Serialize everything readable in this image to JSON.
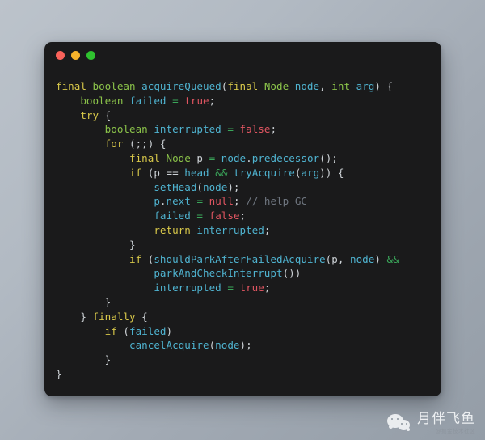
{
  "window": {
    "traffic_lights": [
      {
        "name": "close-button",
        "color": "#f9625a"
      },
      {
        "name": "minimize-button",
        "color": "#f7b32b"
      },
      {
        "name": "maximize-button",
        "color": "#2fc22f"
      }
    ]
  },
  "code": {
    "language": "java",
    "lines": [
      [
        {
          "t": "final ",
          "c": "kw"
        },
        {
          "t": "boolean ",
          "c": "typ"
        },
        {
          "t": "acquireQueued",
          "c": "fn"
        },
        {
          "t": "(",
          "c": "pln"
        },
        {
          "t": "final ",
          "c": "kw"
        },
        {
          "t": "Node ",
          "c": "typ"
        },
        {
          "t": "node",
          "c": "idn"
        },
        {
          "t": ", ",
          "c": "pln"
        },
        {
          "t": "int ",
          "c": "typ"
        },
        {
          "t": "arg",
          "c": "idn"
        },
        {
          "t": ") {",
          "c": "pln"
        }
      ],
      [
        {
          "t": "    ",
          "c": "pln"
        },
        {
          "t": "boolean ",
          "c": "typ"
        },
        {
          "t": "failed",
          "c": "idn"
        },
        {
          "t": " ",
          "c": "pln"
        },
        {
          "t": "=",
          "c": "op"
        },
        {
          "t": " ",
          "c": "pln"
        },
        {
          "t": "true",
          "c": "lit"
        },
        {
          "t": ";",
          "c": "pln"
        }
      ],
      [
        {
          "t": "    ",
          "c": "pln"
        },
        {
          "t": "try",
          "c": "kw"
        },
        {
          "t": " {",
          "c": "pln"
        }
      ],
      [
        {
          "t": "        ",
          "c": "pln"
        },
        {
          "t": "boolean ",
          "c": "typ"
        },
        {
          "t": "interrupted",
          "c": "idn"
        },
        {
          "t": " ",
          "c": "pln"
        },
        {
          "t": "=",
          "c": "op"
        },
        {
          "t": " ",
          "c": "pln"
        },
        {
          "t": "false",
          "c": "lit"
        },
        {
          "t": ";",
          "c": "pln"
        }
      ],
      [
        {
          "t": "        ",
          "c": "pln"
        },
        {
          "t": "for",
          "c": "kw"
        },
        {
          "t": " (;;) {",
          "c": "pln"
        }
      ],
      [
        {
          "t": "            ",
          "c": "pln"
        },
        {
          "t": "final ",
          "c": "kw"
        },
        {
          "t": "Node ",
          "c": "typ"
        },
        {
          "t": "p",
          "c": "pln"
        },
        {
          "t": " ",
          "c": "pln"
        },
        {
          "t": "=",
          "c": "op"
        },
        {
          "t": " ",
          "c": "pln"
        },
        {
          "t": "node",
          "c": "idn"
        },
        {
          "t": ".",
          "c": "pln"
        },
        {
          "t": "predecessor",
          "c": "fn"
        },
        {
          "t": "();",
          "c": "pln"
        }
      ],
      [
        {
          "t": "            ",
          "c": "pln"
        },
        {
          "t": "if",
          "c": "kw"
        },
        {
          "t": " (",
          "c": "pln"
        },
        {
          "t": "p",
          "c": "pln"
        },
        {
          "t": " ",
          "c": "pln"
        },
        {
          "t": "==",
          "c": "pln"
        },
        {
          "t": " ",
          "c": "pln"
        },
        {
          "t": "head",
          "c": "idn"
        },
        {
          "t": " ",
          "c": "pln"
        },
        {
          "t": "&&",
          "c": "op"
        },
        {
          "t": " ",
          "c": "pln"
        },
        {
          "t": "tryAcquire",
          "c": "fn"
        },
        {
          "t": "(",
          "c": "pln"
        },
        {
          "t": "arg",
          "c": "idn"
        },
        {
          "t": ")) {",
          "c": "pln"
        }
      ],
      [
        {
          "t": "                ",
          "c": "pln"
        },
        {
          "t": "setHead",
          "c": "fn"
        },
        {
          "t": "(",
          "c": "pln"
        },
        {
          "t": "node",
          "c": "idn"
        },
        {
          "t": ");",
          "c": "pln"
        }
      ],
      [
        {
          "t": "                ",
          "c": "pln"
        },
        {
          "t": "p",
          "c": "idn"
        },
        {
          "t": ".",
          "c": "pln"
        },
        {
          "t": "next",
          "c": "idn"
        },
        {
          "t": " ",
          "c": "pln"
        },
        {
          "t": "=",
          "c": "op"
        },
        {
          "t": " ",
          "c": "pln"
        },
        {
          "t": "null",
          "c": "lit"
        },
        {
          "t": "; ",
          "c": "pln"
        },
        {
          "t": "// help GC",
          "c": "cmt"
        }
      ],
      [
        {
          "t": "                ",
          "c": "pln"
        },
        {
          "t": "failed",
          "c": "idn"
        },
        {
          "t": " ",
          "c": "pln"
        },
        {
          "t": "=",
          "c": "op"
        },
        {
          "t": " ",
          "c": "pln"
        },
        {
          "t": "false",
          "c": "lit"
        },
        {
          "t": ";",
          "c": "pln"
        }
      ],
      [
        {
          "t": "                ",
          "c": "pln"
        },
        {
          "t": "return",
          "c": "kw"
        },
        {
          "t": " ",
          "c": "pln"
        },
        {
          "t": "interrupted",
          "c": "idn"
        },
        {
          "t": ";",
          "c": "pln"
        }
      ],
      [
        {
          "t": "            }",
          "c": "pln"
        }
      ],
      [
        {
          "t": "            ",
          "c": "pln"
        },
        {
          "t": "if",
          "c": "kw"
        },
        {
          "t": " (",
          "c": "pln"
        },
        {
          "t": "shouldParkAfterFailedAcquire",
          "c": "fn"
        },
        {
          "t": "(",
          "c": "pln"
        },
        {
          "t": "p",
          "c": "pln"
        },
        {
          "t": ", ",
          "c": "pln"
        },
        {
          "t": "node",
          "c": "idn"
        },
        {
          "t": ") ",
          "c": "pln"
        },
        {
          "t": "&&",
          "c": "op"
        }
      ],
      [
        {
          "t": "                ",
          "c": "pln"
        },
        {
          "t": "parkAndCheckInterrupt",
          "c": "fn"
        },
        {
          "t": "())",
          "c": "pln"
        }
      ],
      [
        {
          "t": "                ",
          "c": "pln"
        },
        {
          "t": "interrupted",
          "c": "idn"
        },
        {
          "t": " ",
          "c": "pln"
        },
        {
          "t": "=",
          "c": "op"
        },
        {
          "t": " ",
          "c": "pln"
        },
        {
          "t": "true",
          "c": "lit"
        },
        {
          "t": ";",
          "c": "pln"
        }
      ],
      [
        {
          "t": "        }",
          "c": "pln"
        }
      ],
      [
        {
          "t": "    } ",
          "c": "pln"
        },
        {
          "t": "finally",
          "c": "kw"
        },
        {
          "t": " {",
          "c": "pln"
        }
      ],
      [
        {
          "t": "        ",
          "c": "pln"
        },
        {
          "t": "if",
          "c": "kw"
        },
        {
          "t": " (",
          "c": "pln"
        },
        {
          "t": "failed",
          "c": "idn"
        },
        {
          "t": ")",
          "c": "pln"
        }
      ],
      [
        {
          "t": "            ",
          "c": "pln"
        },
        {
          "t": "cancelAcquire",
          "c": "fn"
        },
        {
          "t": "(",
          "c": "pln"
        },
        {
          "t": "node",
          "c": "idn"
        },
        {
          "t": ");",
          "c": "pln"
        }
      ],
      [
        {
          "t": "        }",
          "c": "pln"
        }
      ],
      [
        {
          "t": "}",
          "c": "pln"
        }
      ]
    ]
  },
  "watermark": {
    "icon": "wechat-logo",
    "title": "月伴飞鱼",
    "subtitle": "@掘金技术社区"
  },
  "theme": {
    "page_background_top": "#bcc3cb",
    "page_background_bottom": "#949da7",
    "window_background": "#1a1a1b",
    "keyword": "#d8c84a",
    "type": "#8bc34a",
    "function": "#4fb3d0",
    "literal": "#e05561",
    "operator": "#3aa65a",
    "plain": "#cdd2d6",
    "comment": "#6f7680"
  }
}
